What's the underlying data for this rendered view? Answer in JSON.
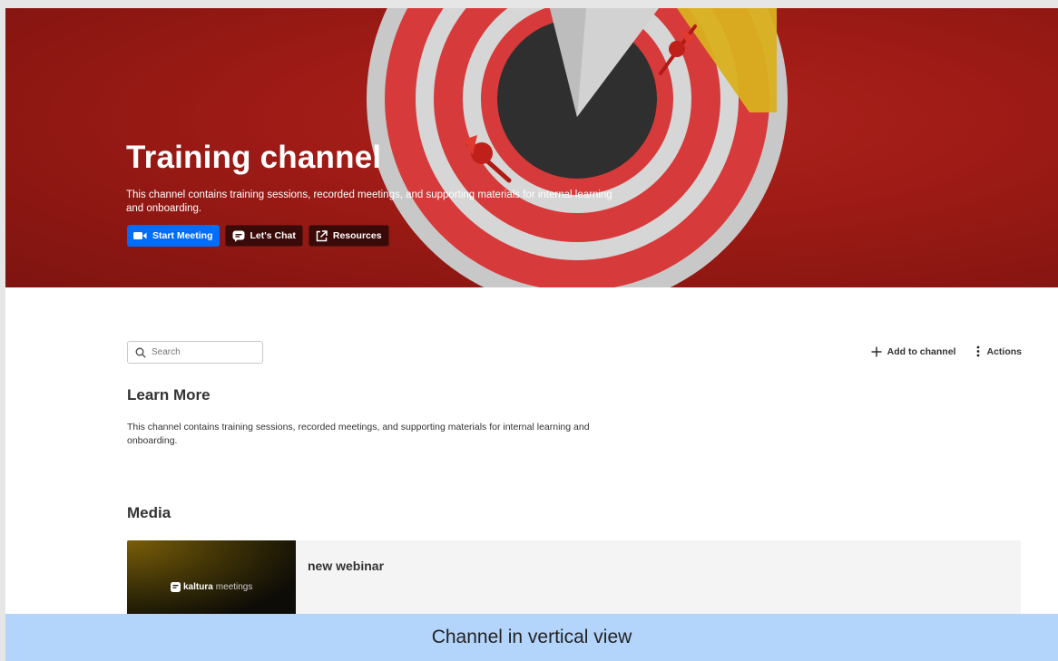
{
  "hero": {
    "title": "Training channel",
    "description": "This channel contains training sessions, recorded meetings, and supporting materials for internal learning and onboarding.",
    "buttons": {
      "start_meeting": "Start Meeting",
      "lets_chat": "Let's Chat",
      "resources": "Resources"
    },
    "colors": {
      "background": "#9c1a15",
      "primary_button": "#006efa"
    }
  },
  "toolbar": {
    "search_placeholder": "Search",
    "add_to_channel": "Add to channel",
    "actions": "Actions"
  },
  "learn_more": {
    "title": "Learn More",
    "text": "This channel contains training sessions, recorded meetings, and supporting materials for internal learning and onboarding."
  },
  "media": {
    "title": "Media",
    "items": [
      {
        "title": "new webinar",
        "thumbnail_brand_bold": "kaltura",
        "thumbnail_brand_light": "meetings"
      }
    ]
  },
  "caption": "Channel in vertical view"
}
